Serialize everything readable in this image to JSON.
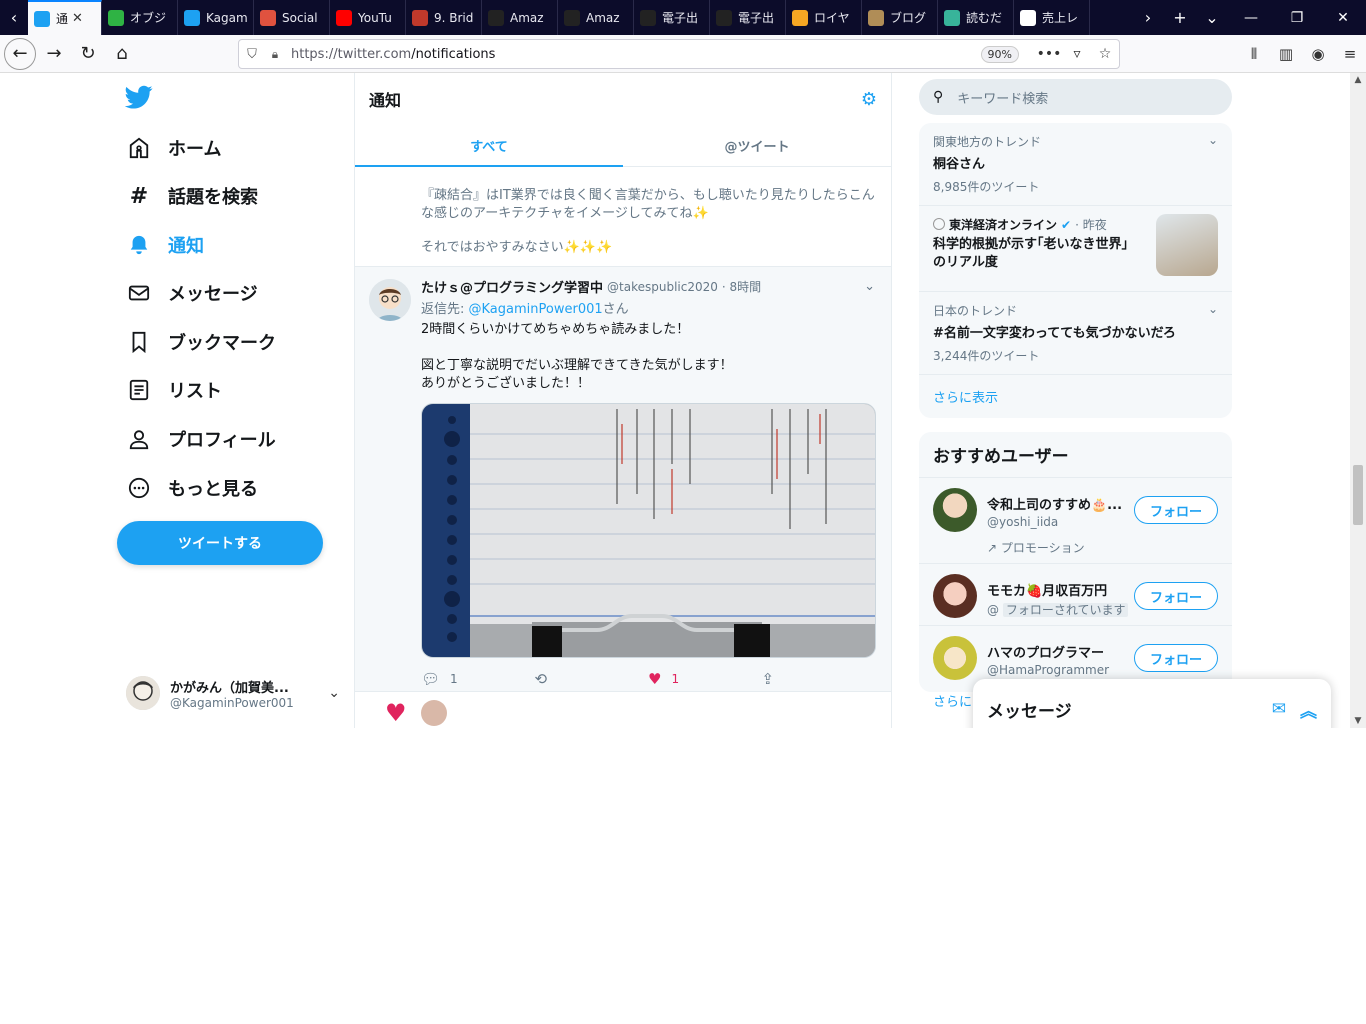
{
  "browser": {
    "tabs": [
      {
        "label": "通",
        "icon": "twitter-icon",
        "color": "#1da1f2",
        "active": true
      },
      {
        "label": "オブジ",
        "icon": "green-circle-icon",
        "color": "#2fb344"
      },
      {
        "label": "Kagam",
        "icon": "twitter-icon",
        "color": "#1da1f2"
      },
      {
        "label": "Social",
        "icon": "social-icon",
        "color": "#e0523f"
      },
      {
        "label": "YouTu",
        "icon": "youtube-icon",
        "color": "#ff0000"
      },
      {
        "label": "9. Brid",
        "icon": "book-icon",
        "color": "#c0392b"
      },
      {
        "label": "Amaz",
        "icon": "amazon-icon",
        "color": "#222"
      },
      {
        "label": "Amaz",
        "icon": "amazon-icon",
        "color": "#222"
      },
      {
        "label": "電子出",
        "icon": "amazon-icon",
        "color": "#222"
      },
      {
        "label": "電子出",
        "icon": "amazon-icon",
        "color": "#222"
      },
      {
        "label": "ロイヤ",
        "icon": "chart-icon",
        "color": "#f5a623"
      },
      {
        "label": "ブログ",
        "icon": "blog-icon",
        "color": "#b08d57"
      },
      {
        "label": "読むだ",
        "icon": "read-icon",
        "color": "#38b49a"
      },
      {
        "label": "売上レ",
        "icon": "sales-icon",
        "color": "#ffffff"
      }
    ],
    "url_domain": "https://twitter.com",
    "url_path": "/notifications",
    "zoom": "90%"
  },
  "nav": {
    "items": [
      {
        "label": "ホーム",
        "icon": "home-icon"
      },
      {
        "label": "話題を検索",
        "icon": "hashtag-icon"
      },
      {
        "label": "通知",
        "icon": "bell-icon",
        "active": true
      },
      {
        "label": "メッセージ",
        "icon": "envelope-icon"
      },
      {
        "label": "ブックマーク",
        "icon": "bookmark-icon"
      },
      {
        "label": "リスト",
        "icon": "list-icon"
      },
      {
        "label": "プロフィール",
        "icon": "person-icon"
      },
      {
        "label": "もっと見る",
        "icon": "more-icon"
      }
    ],
    "tweet_button": "ツイートする",
    "account_name": "かがみん（加賀美...",
    "account_handle": "@KagaminPower001"
  },
  "center": {
    "title": "通知",
    "tabs": [
      "すべて",
      "@ツイート"
    ],
    "prev_text_1": "『疎結合』はIT業界では良く聞く言葉だから、もし聴いたり見たりしたらこんな感じのアーキテクチャをイメージしてみてね✨",
    "prev_text_2": "それではおやすみなさい✨✨✨",
    "tweet": {
      "name": "たけｓ@プログラミング学習中",
      "handle": "@takespublic2020",
      "time": "· 8時間",
      "reply_prefix": "返信先: ",
      "reply_to": "@KagaminPower001",
      "reply_suffix": "さん",
      "line1": "2時間くらいかけてめちゃめちゃ読みました！",
      "line2": "図と丁寧な説明でだいぶ理解できてきた気がします！",
      "line3": "ありがとうございました！！",
      "reply_count": "1",
      "like_count": "1"
    }
  },
  "right": {
    "search_placeholder": "キーワード検索",
    "trends": [
      {
        "meta": "関東地方のトレンド",
        "title": "桐谷さん",
        "count": "8,985件のツイート"
      },
      {
        "meta_source": "東洋経済オンライン",
        "meta_time": "· 昨夜",
        "title": "科学的根拠が示す｢老いなき世界｣のリアル度"
      },
      {
        "meta": "日本のトレンド",
        "title": "#名前一文字変わってても気づかないだろ",
        "count": "3,244件のツイート"
      }
    ],
    "show_more": "さらに表示",
    "wtf_title": "おすすめユーザー",
    "users": [
      {
        "name": "令和上司のすすめ🎂...",
        "handle": "@yoshi_iida",
        "promo": "プロモーション",
        "follow": "フォロー"
      },
      {
        "name": "モモカ🍓月収百万円",
        "handle": "@",
        "follows_you": "フォローされています",
        "follow": "フォロー"
      },
      {
        "name": "ハマのプログラマー",
        "handle": "@HamaProgrammer",
        "follow": "フォロー"
      }
    ],
    "show_more_2": "さらに"
  },
  "messages_drawer": {
    "title": "メッセージ"
  }
}
